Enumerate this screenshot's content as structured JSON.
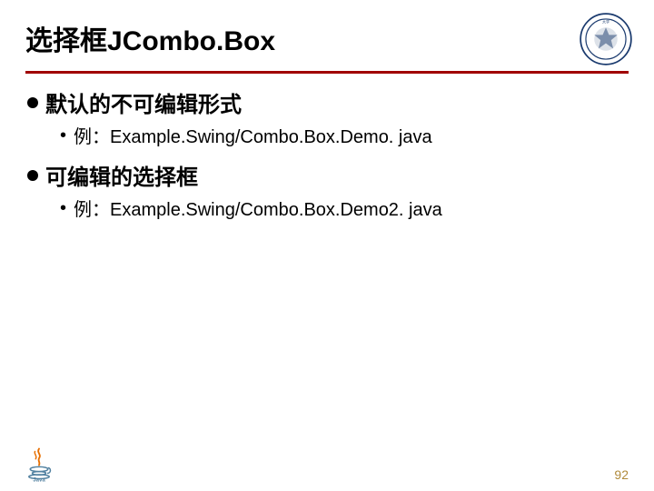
{
  "title": "选择框JCombo.Box",
  "bullets": {
    "item1": {
      "heading": "默认的不可编辑形式",
      "sub": "例：Example.Swing/Combo.Box.Demo. java"
    },
    "item2": {
      "heading": "可编辑的选择框",
      "sub": "例：Example.Swing/Combo.Box.Demo2. java"
    }
  },
  "page_number": "92",
  "colors": {
    "underline": "#a00000",
    "page_num": "#b08a3a",
    "seal": "#1a3a6e"
  }
}
